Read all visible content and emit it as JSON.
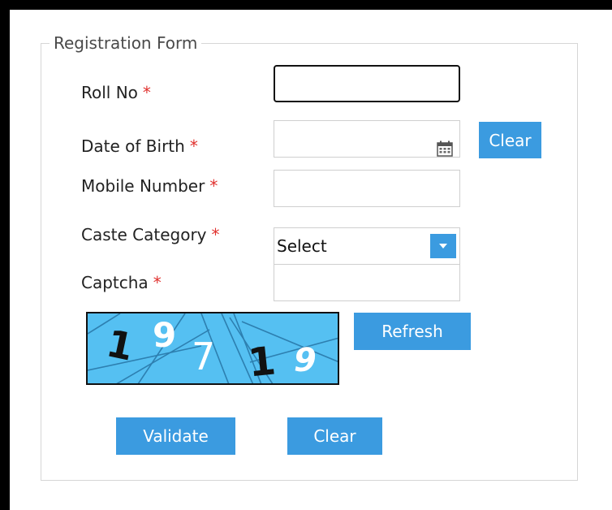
{
  "form": {
    "legend": "Registration Form",
    "required_marker": "*"
  },
  "fields": {
    "roll_no": {
      "label": "Roll No",
      "value": ""
    },
    "dob": {
      "label": "Date of Birth",
      "value": "",
      "icon": "calendar-icon"
    },
    "mobile": {
      "label": "Mobile Number",
      "value": ""
    },
    "caste": {
      "label": "Caste Category",
      "selected": "Select",
      "icon": "chevron-down-icon"
    },
    "captcha": {
      "label": "Captcha",
      "value": ""
    }
  },
  "buttons": {
    "dob_clear": "Clear",
    "refresh": "Refresh",
    "validate": "Validate",
    "clear": "Clear"
  },
  "captcha_image": {
    "characters": [
      "1",
      "9",
      "7",
      "1",
      "9"
    ],
    "background_color": "#55c0f2"
  },
  "colors": {
    "accent": "#3b9be0",
    "required": "#e0312e",
    "border": "#cfcfcf"
  }
}
